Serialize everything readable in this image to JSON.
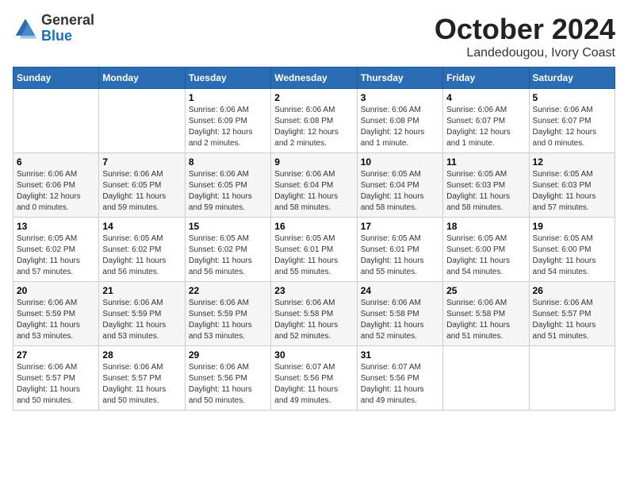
{
  "logo": {
    "general": "General",
    "blue": "Blue"
  },
  "title": "October 2024",
  "subtitle": "Landedougou, Ivory Coast",
  "days_header": [
    "Sunday",
    "Monday",
    "Tuesday",
    "Wednesday",
    "Thursday",
    "Friday",
    "Saturday"
  ],
  "weeks": [
    [
      {
        "day": "",
        "info": ""
      },
      {
        "day": "",
        "info": ""
      },
      {
        "day": "1",
        "info": "Sunrise: 6:06 AM\nSunset: 6:09 PM\nDaylight: 12 hours\nand 2 minutes."
      },
      {
        "day": "2",
        "info": "Sunrise: 6:06 AM\nSunset: 6:08 PM\nDaylight: 12 hours\nand 2 minutes."
      },
      {
        "day": "3",
        "info": "Sunrise: 6:06 AM\nSunset: 6:08 PM\nDaylight: 12 hours\nand 1 minute."
      },
      {
        "day": "4",
        "info": "Sunrise: 6:06 AM\nSunset: 6:07 PM\nDaylight: 12 hours\nand 1 minute."
      },
      {
        "day": "5",
        "info": "Sunrise: 6:06 AM\nSunset: 6:07 PM\nDaylight: 12 hours\nand 0 minutes."
      }
    ],
    [
      {
        "day": "6",
        "info": "Sunrise: 6:06 AM\nSunset: 6:06 PM\nDaylight: 12 hours\nand 0 minutes."
      },
      {
        "day": "7",
        "info": "Sunrise: 6:06 AM\nSunset: 6:05 PM\nDaylight: 11 hours\nand 59 minutes."
      },
      {
        "day": "8",
        "info": "Sunrise: 6:06 AM\nSunset: 6:05 PM\nDaylight: 11 hours\nand 59 minutes."
      },
      {
        "day": "9",
        "info": "Sunrise: 6:06 AM\nSunset: 6:04 PM\nDaylight: 11 hours\nand 58 minutes."
      },
      {
        "day": "10",
        "info": "Sunrise: 6:05 AM\nSunset: 6:04 PM\nDaylight: 11 hours\nand 58 minutes."
      },
      {
        "day": "11",
        "info": "Sunrise: 6:05 AM\nSunset: 6:03 PM\nDaylight: 11 hours\nand 58 minutes."
      },
      {
        "day": "12",
        "info": "Sunrise: 6:05 AM\nSunset: 6:03 PM\nDaylight: 11 hours\nand 57 minutes."
      }
    ],
    [
      {
        "day": "13",
        "info": "Sunrise: 6:05 AM\nSunset: 6:02 PM\nDaylight: 11 hours\nand 57 minutes."
      },
      {
        "day": "14",
        "info": "Sunrise: 6:05 AM\nSunset: 6:02 PM\nDaylight: 11 hours\nand 56 minutes."
      },
      {
        "day": "15",
        "info": "Sunrise: 6:05 AM\nSunset: 6:02 PM\nDaylight: 11 hours\nand 56 minutes."
      },
      {
        "day": "16",
        "info": "Sunrise: 6:05 AM\nSunset: 6:01 PM\nDaylight: 11 hours\nand 55 minutes."
      },
      {
        "day": "17",
        "info": "Sunrise: 6:05 AM\nSunset: 6:01 PM\nDaylight: 11 hours\nand 55 minutes."
      },
      {
        "day": "18",
        "info": "Sunrise: 6:05 AM\nSunset: 6:00 PM\nDaylight: 11 hours\nand 54 minutes."
      },
      {
        "day": "19",
        "info": "Sunrise: 6:05 AM\nSunset: 6:00 PM\nDaylight: 11 hours\nand 54 minutes."
      }
    ],
    [
      {
        "day": "20",
        "info": "Sunrise: 6:06 AM\nSunset: 5:59 PM\nDaylight: 11 hours\nand 53 minutes."
      },
      {
        "day": "21",
        "info": "Sunrise: 6:06 AM\nSunset: 5:59 PM\nDaylight: 11 hours\nand 53 minutes."
      },
      {
        "day": "22",
        "info": "Sunrise: 6:06 AM\nSunset: 5:59 PM\nDaylight: 11 hours\nand 53 minutes."
      },
      {
        "day": "23",
        "info": "Sunrise: 6:06 AM\nSunset: 5:58 PM\nDaylight: 11 hours\nand 52 minutes."
      },
      {
        "day": "24",
        "info": "Sunrise: 6:06 AM\nSunset: 5:58 PM\nDaylight: 11 hours\nand 52 minutes."
      },
      {
        "day": "25",
        "info": "Sunrise: 6:06 AM\nSunset: 5:58 PM\nDaylight: 11 hours\nand 51 minutes."
      },
      {
        "day": "26",
        "info": "Sunrise: 6:06 AM\nSunset: 5:57 PM\nDaylight: 11 hours\nand 51 minutes."
      }
    ],
    [
      {
        "day": "27",
        "info": "Sunrise: 6:06 AM\nSunset: 5:57 PM\nDaylight: 11 hours\nand 50 minutes."
      },
      {
        "day": "28",
        "info": "Sunrise: 6:06 AM\nSunset: 5:57 PM\nDaylight: 11 hours\nand 50 minutes."
      },
      {
        "day": "29",
        "info": "Sunrise: 6:06 AM\nSunset: 5:56 PM\nDaylight: 11 hours\nand 50 minutes."
      },
      {
        "day": "30",
        "info": "Sunrise: 6:07 AM\nSunset: 5:56 PM\nDaylight: 11 hours\nand 49 minutes."
      },
      {
        "day": "31",
        "info": "Sunrise: 6:07 AM\nSunset: 5:56 PM\nDaylight: 11 hours\nand 49 minutes."
      },
      {
        "day": "",
        "info": ""
      },
      {
        "day": "",
        "info": ""
      }
    ]
  ]
}
